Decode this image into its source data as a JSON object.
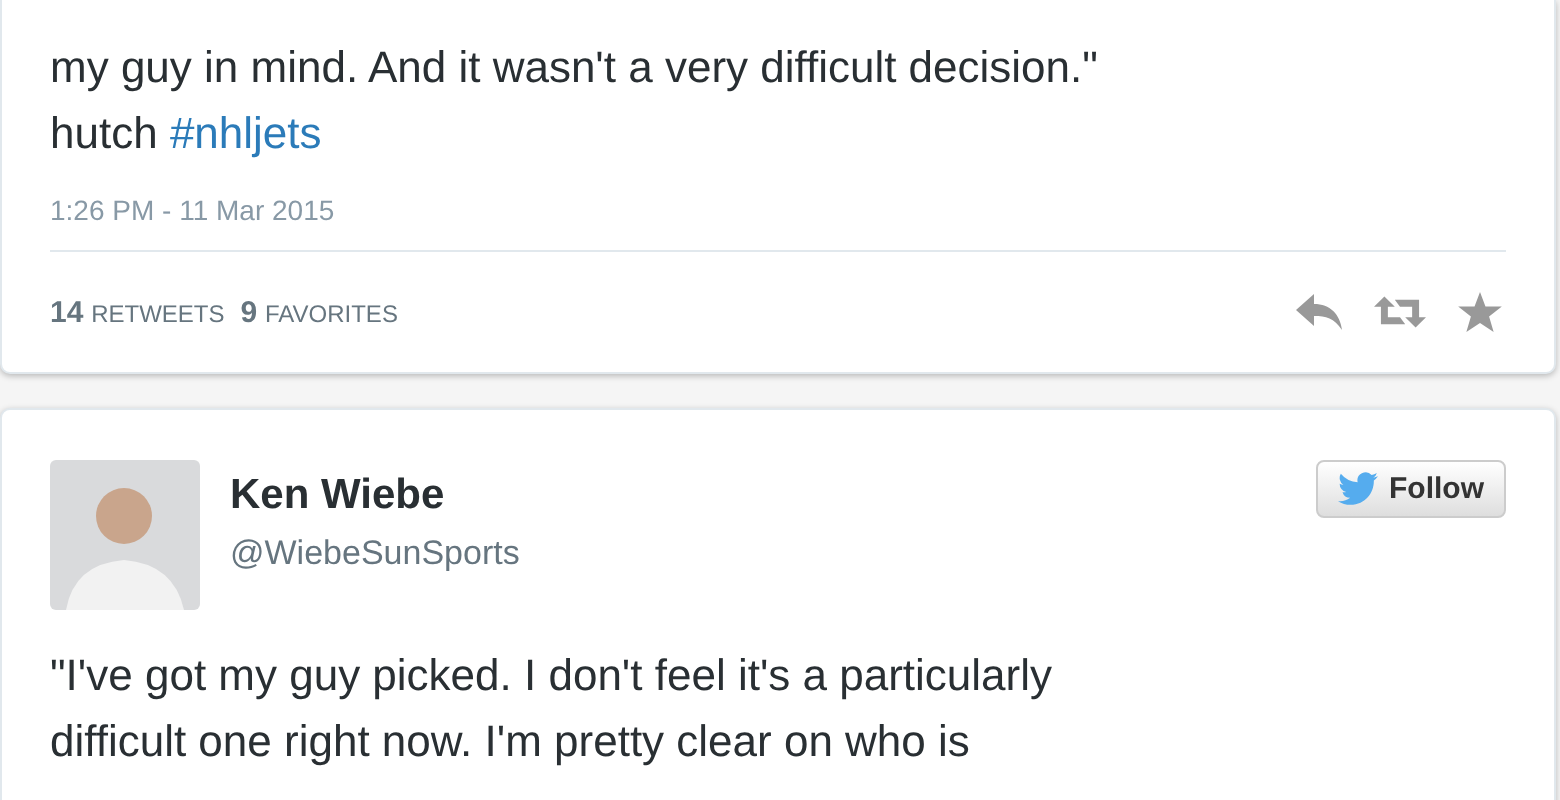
{
  "tweets": [
    {
      "lines": [
        [
          {
            "kind": "plain",
            "text": "my guy in mind. And it wasn't a very difficult decision.\""
          }
        ],
        [
          {
            "kind": "plain",
            "text": "hutch "
          },
          {
            "kind": "hashtag",
            "text": "#nhljets"
          }
        ]
      ],
      "time": "1:26 PM - 11 Mar 2015",
      "stats": [
        {
          "count": "14",
          "label": "RETWEETS"
        },
        {
          "count": "9",
          "label": "FAVORITES"
        }
      ]
    },
    {
      "author": {
        "name": "Ken Wiebe",
        "handle": "@WiebeSunSports"
      },
      "follow": "Follow",
      "lines": [
        [
          {
            "kind": "plain",
            "text": "\"I've got my guy picked. I don't feel it's a particularly"
          }
        ],
        [
          {
            "kind": "plain",
            "text": "difficult one right now. I'm pretty clear on who is"
          }
        ]
      ]
    }
  ]
}
